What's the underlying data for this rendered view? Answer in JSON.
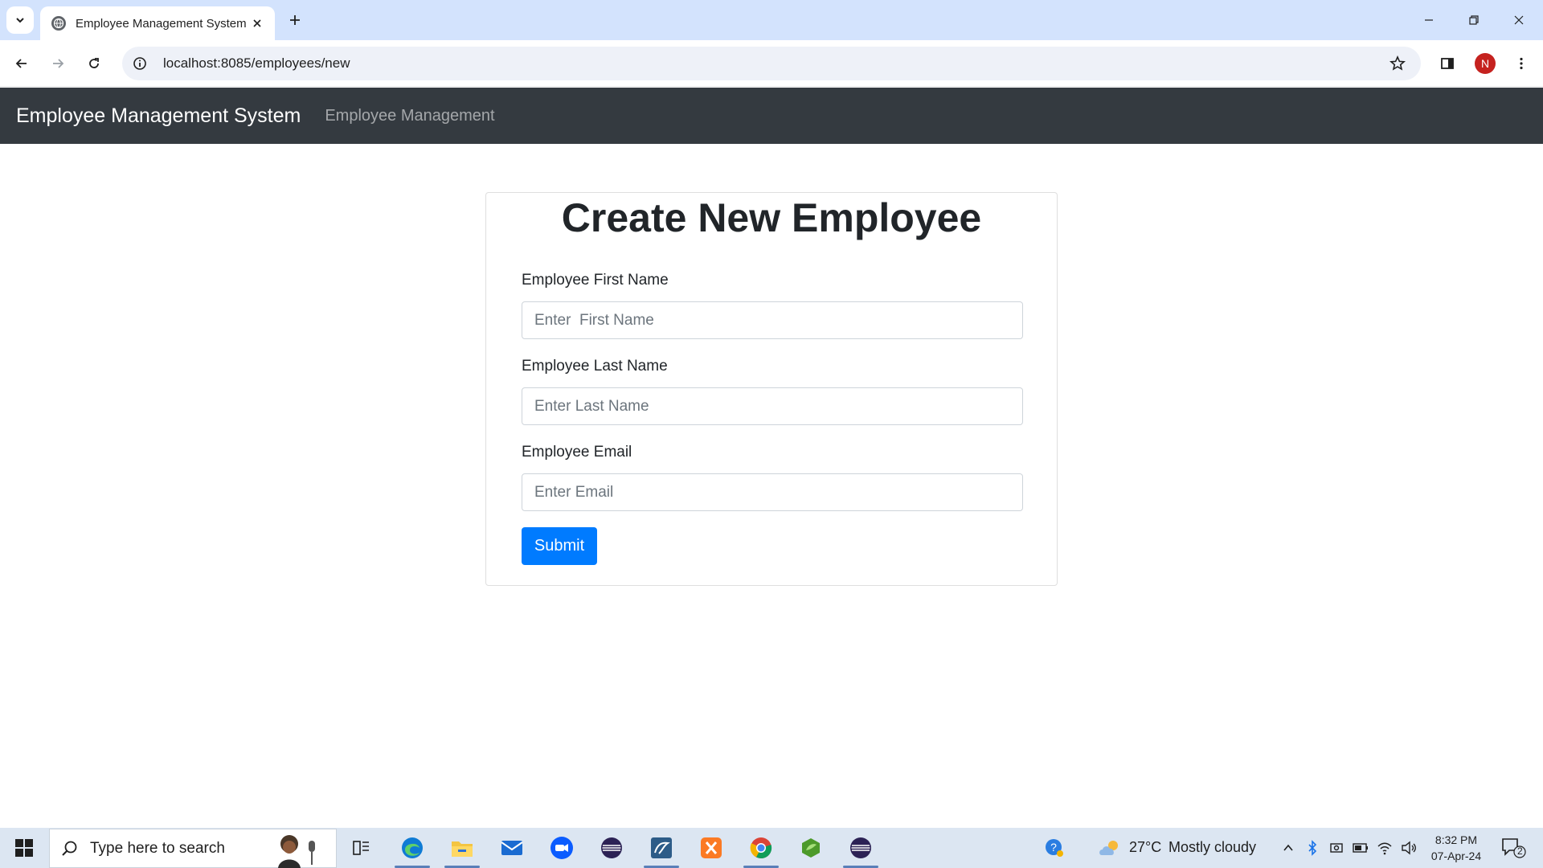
{
  "browser": {
    "tab_title": "Employee Management System",
    "url": "localhost:8085/employees/new",
    "profile_initial": "N"
  },
  "navbar": {
    "brand": "Employee Management System",
    "link": "Employee Management"
  },
  "form": {
    "title": "Create New Employee",
    "first_name_label": "Employee First Name",
    "first_name_placeholder": "Enter  First Name",
    "last_name_label": "Employee Last Name",
    "last_name_placeholder": "Enter Last Name",
    "email_label": "Employee Email",
    "email_placeholder": "Enter Email",
    "submit_label": "Submit"
  },
  "taskbar": {
    "search_placeholder": "Type here to search",
    "weather_temp": "27°C",
    "weather_text": "Mostly cloudy",
    "time": "8:32 PM",
    "date": "07-Apr-24",
    "notification_count": "2",
    "apps": [
      "task-view",
      "edge",
      "file-explorer",
      "mail",
      "zoom",
      "eclipse",
      "mysql-workbench",
      "xampp",
      "chrome",
      "spring-tool-suite",
      "eclipse"
    ]
  },
  "colors": {
    "navbar_bg": "#343a40",
    "primary": "#007bff",
    "tabstrip_bg": "#d3e3fd",
    "taskbar_bg": "#dce6f2"
  }
}
